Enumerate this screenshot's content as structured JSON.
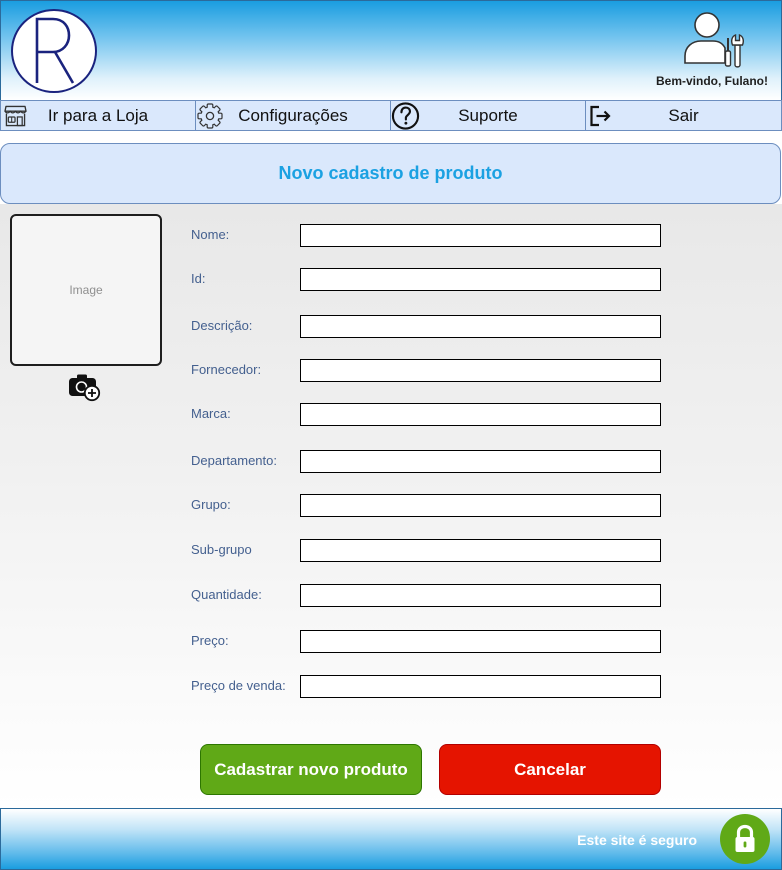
{
  "header": {
    "logo_letter": "R",
    "welcome_text": "Bem-vindo, Fulano!",
    "avatar_icon": "user-tools-icon"
  },
  "nav": {
    "items": [
      {
        "label": "Ir para a Loja",
        "icon": "store-icon"
      },
      {
        "label": "Configurações",
        "icon": "gear-icon"
      },
      {
        "label": "Suporte",
        "icon": "help-circle-icon"
      },
      {
        "label": "Sair",
        "icon": "logout-icon"
      }
    ]
  },
  "page": {
    "title": "Novo cadastro de produto"
  },
  "product_image": {
    "placeholder_label": "Image",
    "upload_icon": "camera-add-icon"
  },
  "form": {
    "fields": [
      {
        "label": "Nome:",
        "value": ""
      },
      {
        "label": "Id:",
        "value": ""
      },
      {
        "label": "Descrição:",
        "value": ""
      },
      {
        "label": "Fornecedor:",
        "value": ""
      },
      {
        "label": "Marca:",
        "value": ""
      },
      {
        "label": "Departamento:",
        "value": ""
      },
      {
        "label": "Grupo:",
        "value": ""
      },
      {
        "label": "Sub-grupo",
        "value": ""
      },
      {
        "label": "Quantidade:",
        "value": ""
      },
      {
        "label": "Preço:",
        "value": ""
      },
      {
        "label": "Preço de venda:",
        "value": ""
      }
    ]
  },
  "actions": {
    "submit_label": "Cadastrar novo produto",
    "cancel_label": "Cancelar"
  },
  "footer": {
    "secure_text": "Este site é seguro",
    "secure_icon": "lock-icon"
  },
  "colors": {
    "header_blue": "#1ba1e2",
    "nav_background": "#dae8fc",
    "nav_border": "#6c8ebf",
    "title_text": "#1ba1e2",
    "logo_navy": "#1a237e",
    "field_label": "#44608f",
    "submit_button": "#60a917",
    "cancel_button": "#e51400",
    "lock_badge": "#60a917"
  }
}
